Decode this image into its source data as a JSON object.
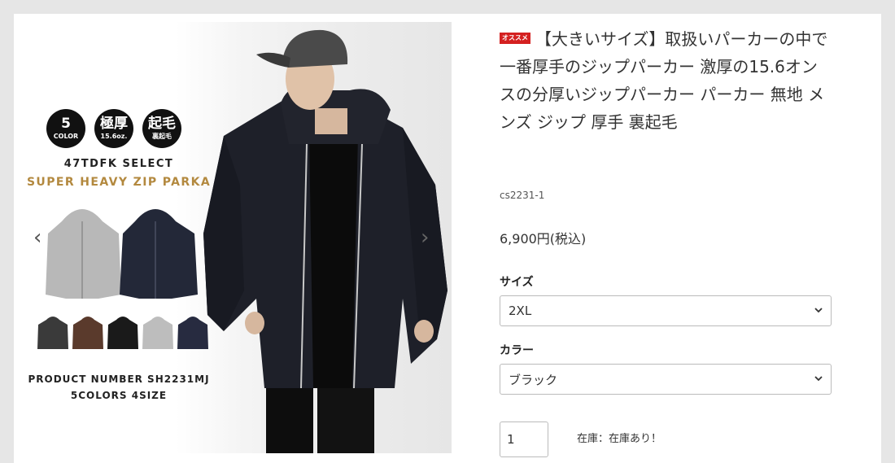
{
  "gallery": {
    "badges": [
      {
        "big": "5",
        "small": "COLOR"
      },
      {
        "big": "極厚",
        "small": "15.6oz."
      },
      {
        "big": "起毛",
        "small": "裏起毛"
      }
    ],
    "brand": "47TDFK SELECT",
    "tagline": "SUPER HEAVY ZIP PARKA",
    "product_number": "PRODUCT NUMBER SH2231MJ",
    "colors_sizes": "5COLORS 4SIZE",
    "prev_arrow": "‹",
    "next_arrow": "›",
    "swatch_colors": [
      "#3a3a3a",
      "#5a3a2c",
      "#1a1a1a",
      "#bdbdbd",
      "#272b40"
    ],
    "hero_colors": {
      "gray": "#b8b8b8",
      "navy": "#232838"
    }
  },
  "product": {
    "badge": "オススメ",
    "title": "【大きいサイズ】取扱いパーカーの中で一番厚手のジップパーカー 激厚の15.6オンスの分厚いジップパーカー パーカー 無地 メンズ ジップ 厚手 裏起毛",
    "sku": "cs2231-1",
    "price": "6,900円(税込)",
    "size_label": "サイズ",
    "size_value": "2XL",
    "color_label": "カラー",
    "color_value": "ブラック",
    "quantity": "1",
    "stock": "在庫：在庫あり！"
  }
}
